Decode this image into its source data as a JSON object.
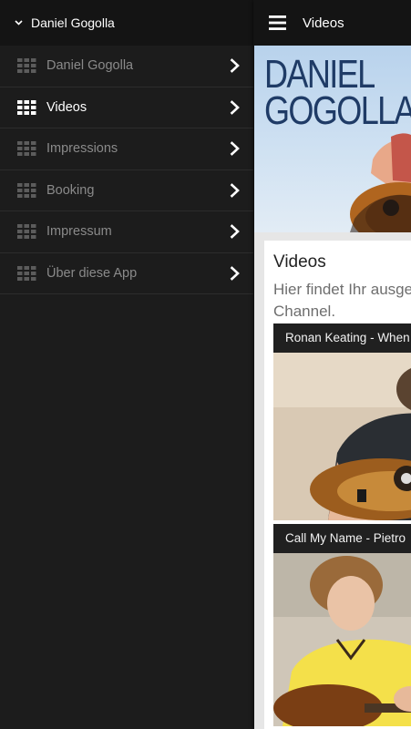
{
  "drawer": {
    "header_title": "Daniel Gogolla",
    "items": [
      {
        "label": "Daniel Gogolla",
        "active": false
      },
      {
        "label": "Videos",
        "active": true
      },
      {
        "label": "Impressions",
        "active": false
      },
      {
        "label": "Booking",
        "active": false
      },
      {
        "label": "Impressum",
        "active": false
      },
      {
        "label": "Über diese App",
        "active": false
      }
    ]
  },
  "appbar": {
    "title": "Videos"
  },
  "hero": {
    "line1": "DANIEL",
    "line2": "GOGOLLA"
  },
  "content": {
    "section_title": "Videos",
    "section_desc": "Hier findet Ihr ausge Tube Channel.",
    "videos": [
      {
        "title": "Ronan Keating - When"
      },
      {
        "title": "Call My Name - Pietro"
      }
    ]
  },
  "colors": {
    "drawer_bg": "#1c1c1c",
    "header_bg": "#141414",
    "inactive_text": "#8a8a8a",
    "active_text": "#ffffff"
  },
  "icons": {
    "header_caret": "chevron-down-icon",
    "menu_item": "grid-icon",
    "menu_arrow": "chevron-right-icon",
    "appbar_menu": "hamburger-menu-icon"
  }
}
